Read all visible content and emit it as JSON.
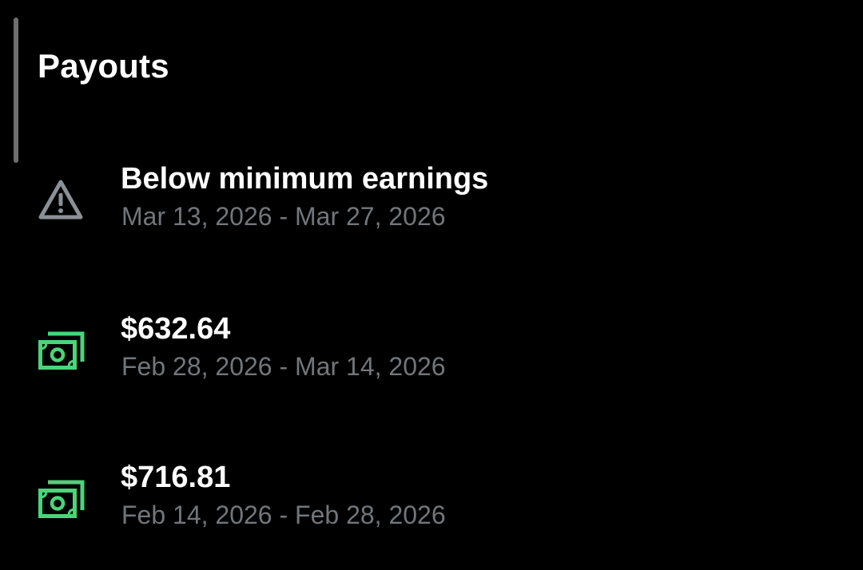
{
  "page": {
    "title": "Payouts"
  },
  "colors": {
    "background": "#000000",
    "primary_text": "#ffffff",
    "secondary_text": "#71767b",
    "money_icon": "#4bd47a",
    "warning_icon": "#8b9096"
  },
  "payouts": [
    {
      "icon": "warning-icon",
      "title": "Below minimum earnings",
      "period": "Mar 13, 2026 - Mar 27, 2026"
    },
    {
      "icon": "money-icon",
      "title": "$632.64",
      "period": "Feb 28, 2026 - Mar 14, 2026"
    },
    {
      "icon": "money-icon",
      "title": "$716.81",
      "period": "Feb 14, 2026 - Feb 28, 2026"
    }
  ]
}
